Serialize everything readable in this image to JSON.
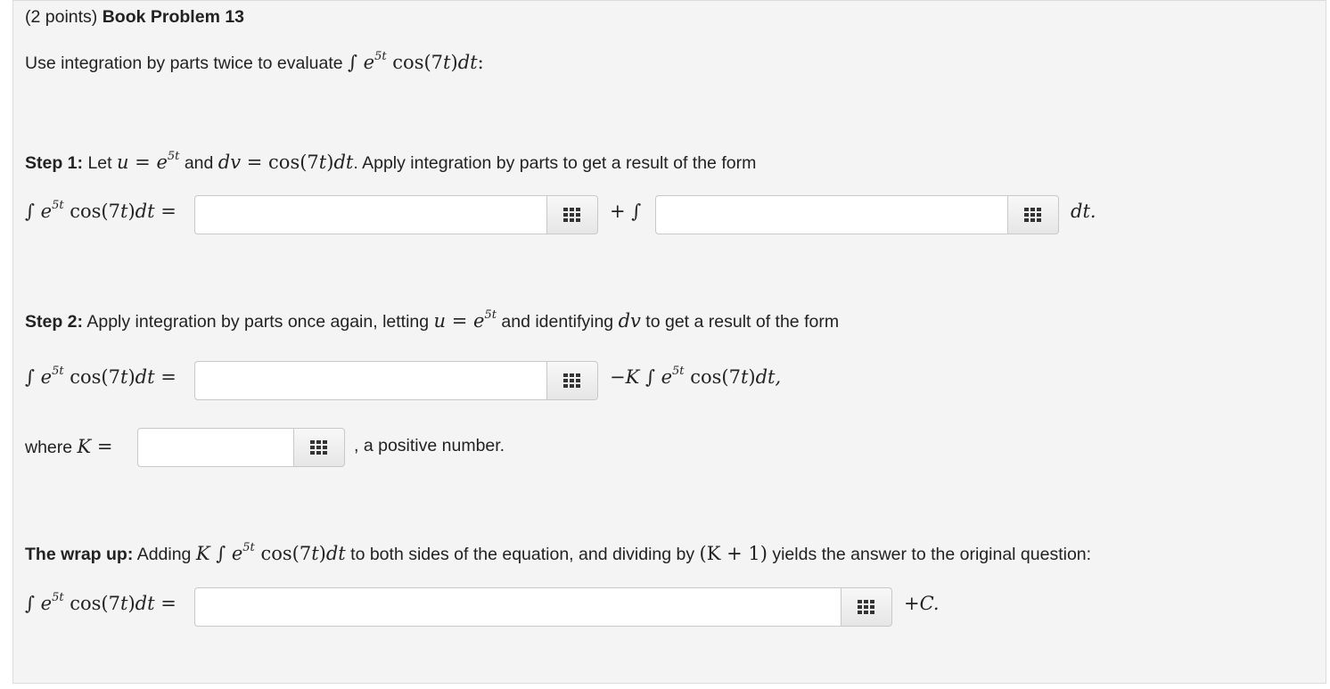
{
  "header": {
    "points": "(2 points)",
    "title": "Book Problem 13"
  },
  "intro": {
    "text": "Use integration by parts twice to evaluate"
  },
  "math": {
    "integral": "∫",
    "e": "e",
    "exp": "5t",
    "cos_open": "cos(7",
    "t": "t",
    "close": ")",
    "dt": "dt",
    "eq": "="
  },
  "step1": {
    "label": "Step 1:",
    "let": "Let",
    "and": "and",
    "apply": ". Apply integration by parts to get a result of the form",
    "plus_int": "+ ∫",
    "dt_end": "dt."
  },
  "step2": {
    "label": "Step 2:",
    "text_a": "Apply integration by parts once again, letting",
    "text_b": "and identifying",
    "text_c": "to get a result of the form",
    "minus_k": "−K ∫",
    "end": "dt,"
  },
  "where": {
    "text": "where",
    "k": "K",
    "after": ", a positive number."
  },
  "wrap": {
    "label": "The wrap up:",
    "adding": "Adding",
    "text_b": "to both sides of the equation, and dividing by",
    "k_plus_1": "(K + 1)",
    "text_c": "yields the answer to the original question:",
    "plus_c": "+C."
  },
  "inputs": {
    "step1_a": "",
    "step1_b": "",
    "step2_a": "",
    "k_value": "",
    "final": ""
  },
  "icons": {
    "keypad": "keypad-icon"
  }
}
